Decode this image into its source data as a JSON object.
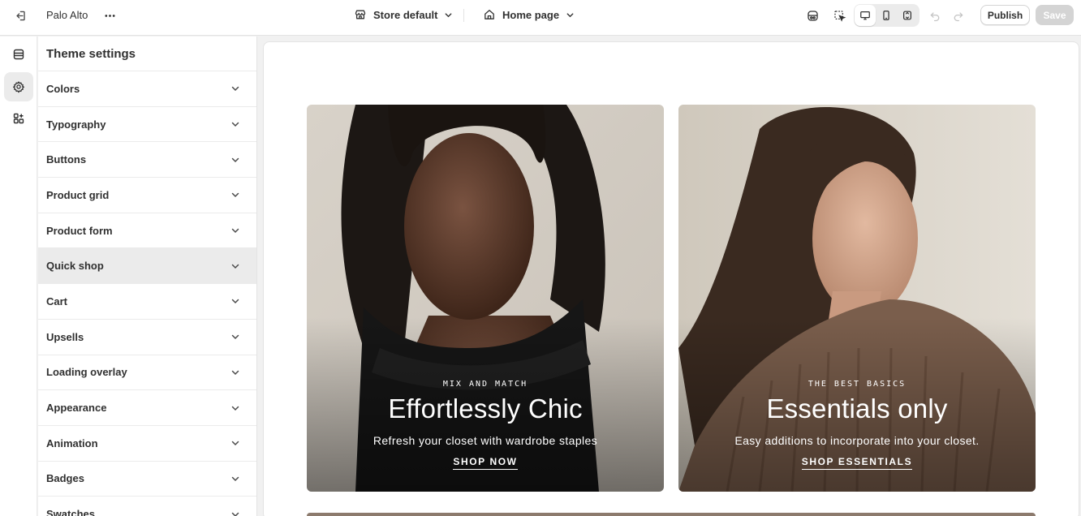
{
  "topbar": {
    "exit_icon": "exit-icon",
    "store_name": "Palo Alto",
    "more_icon": "more-horizontal-icon",
    "store_selector": {
      "icon": "store-icon",
      "label": "Store default"
    },
    "page_selector": {
      "icon": "home-icon",
      "label": "Home page"
    },
    "right_icons": [
      "app-embeds-icon",
      "inspector-icon"
    ],
    "view_modes": [
      {
        "icon": "desktop-icon",
        "active": true
      },
      {
        "icon": "mobile-icon",
        "active": false
      },
      {
        "icon": "fullscreen-icon",
        "active": false
      }
    ],
    "undo_icon": "undo-icon",
    "redo_icon": "redo-icon",
    "publish_label": "Publish",
    "save_label": "Save"
  },
  "rail": {
    "items": [
      {
        "icon": "sections-icon",
        "active": false
      },
      {
        "icon": "settings-gear-icon",
        "active": true
      },
      {
        "icon": "apps-icon",
        "active": false
      }
    ]
  },
  "panel": {
    "title": "Theme settings",
    "items": [
      {
        "label": "Colors"
      },
      {
        "label": "Typography"
      },
      {
        "label": "Buttons"
      },
      {
        "label": "Product grid"
      },
      {
        "label": "Product form"
      },
      {
        "label": "Quick shop",
        "hover": true
      },
      {
        "label": "Cart"
      },
      {
        "label": "Upsells"
      },
      {
        "label": "Loading overlay"
      },
      {
        "label": "Appearance"
      },
      {
        "label": "Animation"
      },
      {
        "label": "Badges"
      },
      {
        "label": "Swatches"
      }
    ]
  },
  "preview": {
    "cards": [
      {
        "kicker": "MIX AND MATCH",
        "headline": "Effortlessly Chic",
        "subtext": "Refresh your closet with wardrobe staples",
        "cta": "SHOP NOW"
      },
      {
        "kicker": "THE BEST BASICS",
        "headline": "Essentials only",
        "subtext": "Easy additions to incorporate into your closet.",
        "cta": "SHOP ESSENTIALS"
      }
    ]
  }
}
